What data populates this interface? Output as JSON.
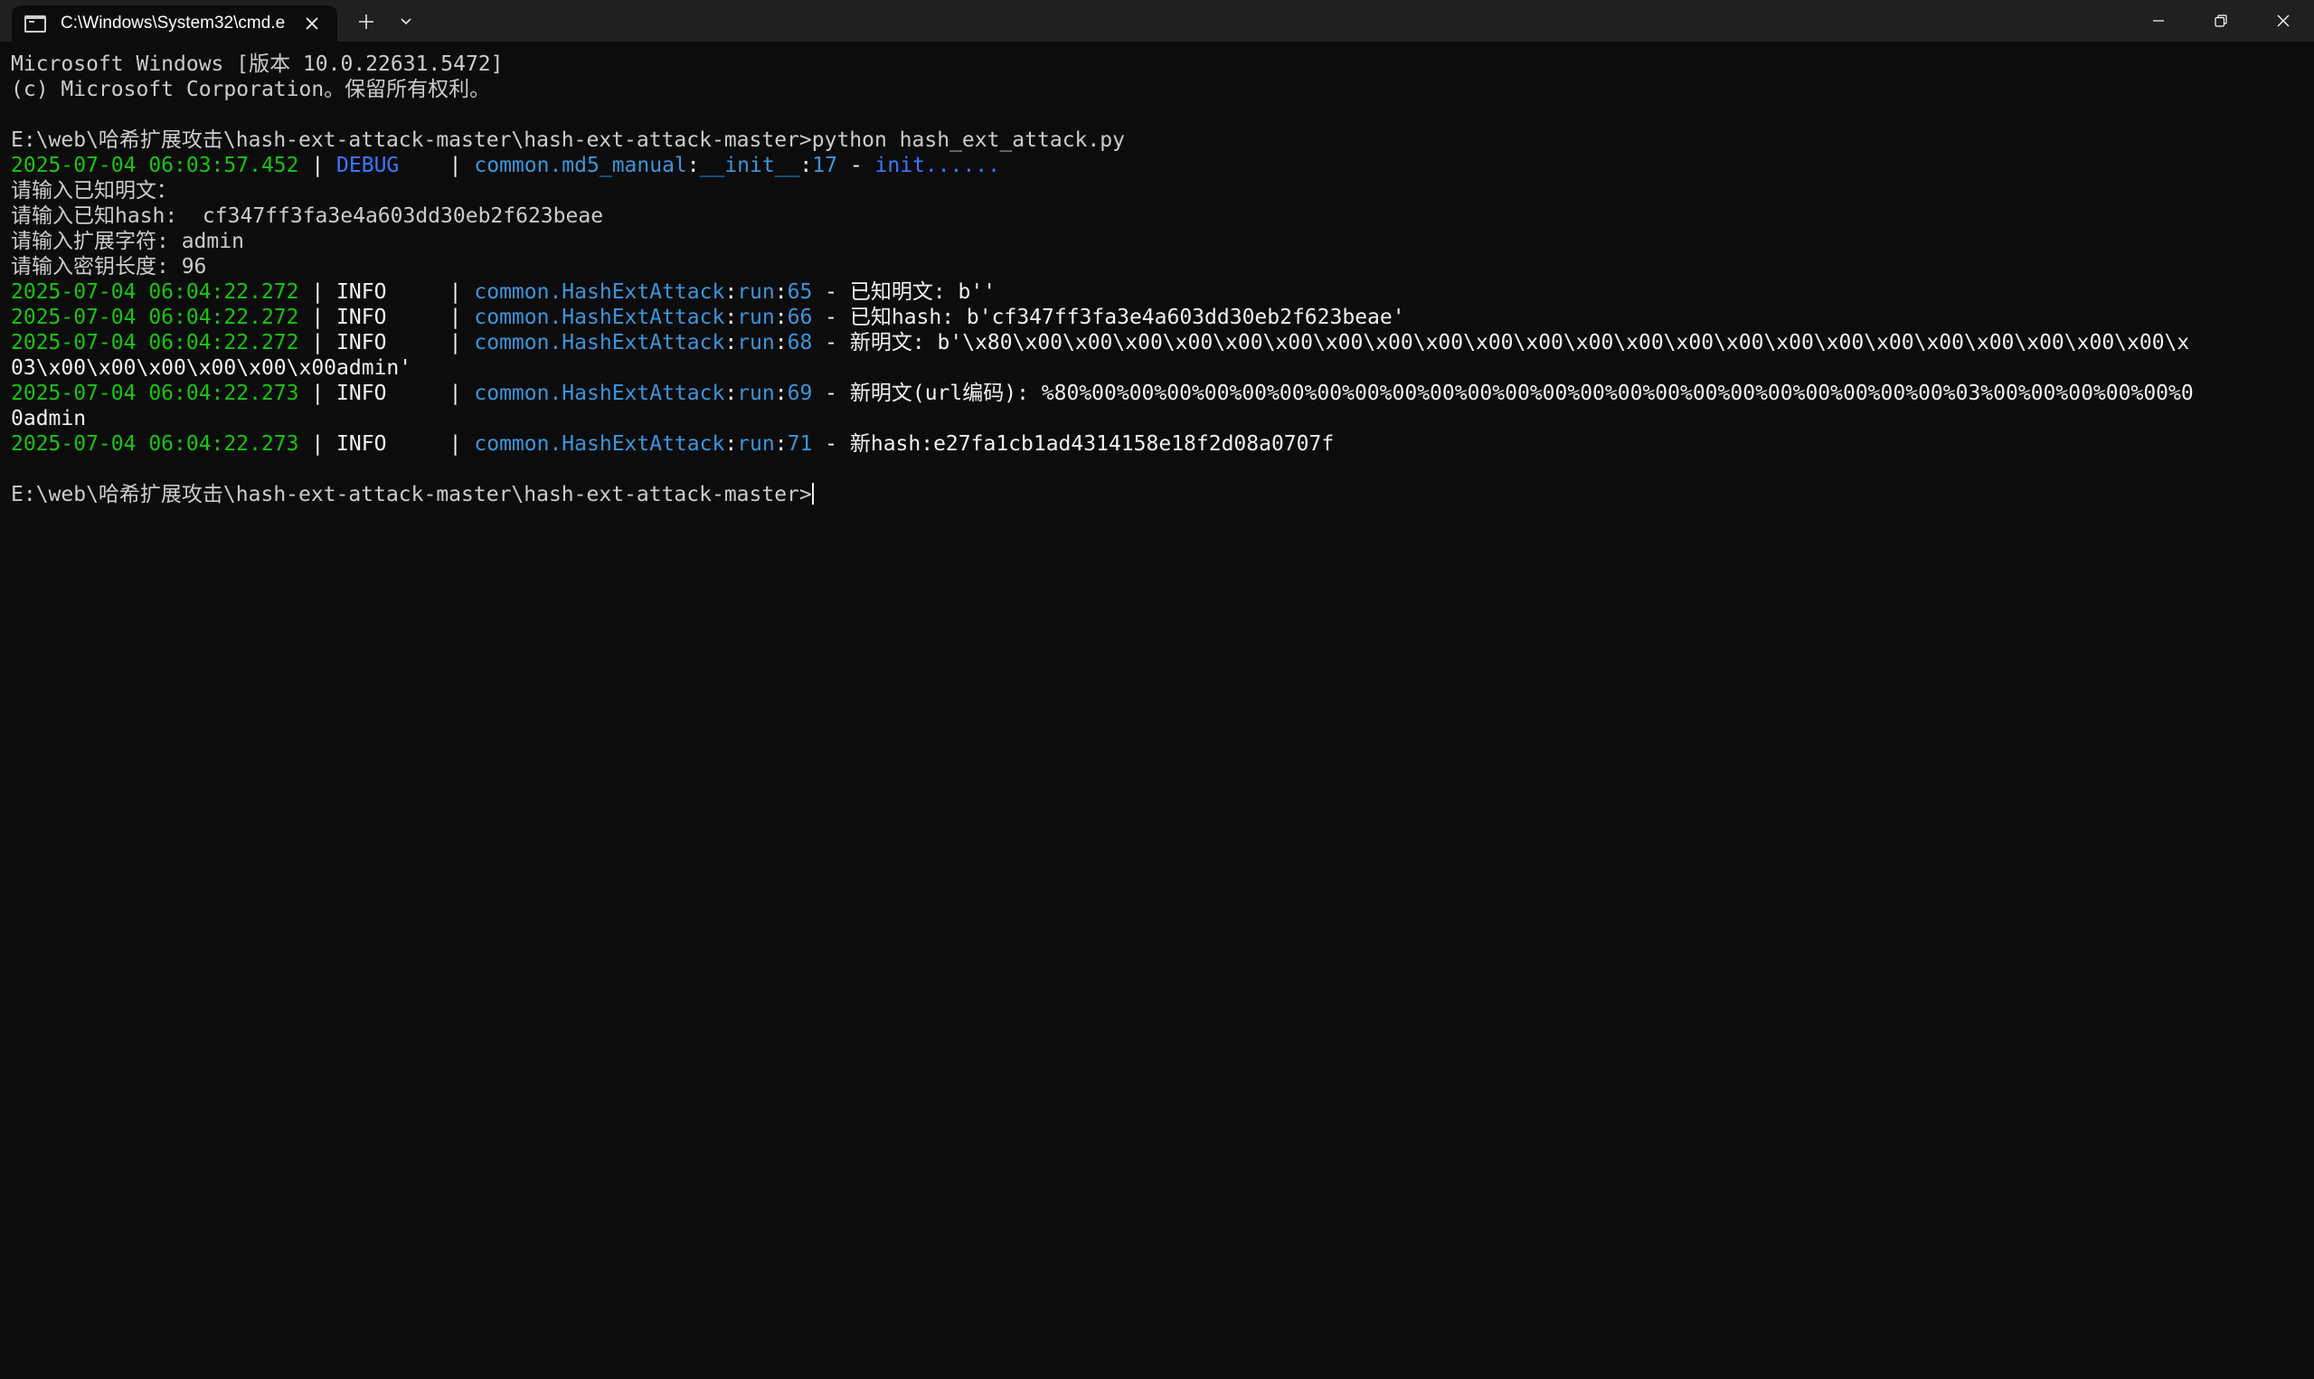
{
  "window": {
    "tab_title": "C:\\Windows\\System32\\cmd.e",
    "new_tab_label": "+"
  },
  "terminal": {
    "banner_line1": "Microsoft Windows [版本 10.0.22631.5472]",
    "banner_line2": "(c) Microsoft Corporation。保留所有权利。",
    "prompt1": "E:\\web\\哈希扩展攻击\\hash-ext-attack-master\\hash-ext-attack-master>",
    "command1": "python hash_ext_attack.py",
    "debug_line": {
      "timestamp": "2025-07-04 06:03:57.452",
      "sep1": " | ",
      "level": "DEBUG   ",
      "sep2": " | ",
      "module": "common.md5_manual",
      "colon1": ":",
      "func": "__init__",
      "colon2": ":",
      "lineno": "17",
      "dash": " - ",
      "message": "init......"
    },
    "input_prompts": [
      "请输入已知明文：",
      "请输入已知hash:  cf347ff3fa3e4a603dd30eb2f623beae",
      "请输入扩展字符: admin",
      "请输入密钥长度: 96"
    ],
    "info_lines": [
      {
        "timestamp": "2025-07-04 06:04:22.272",
        "level": "INFO    ",
        "module": "common.HashExtAttack",
        "func": "run",
        "lineno": "65",
        "message": "已知明文: b''"
      },
      {
        "timestamp": "2025-07-04 06:04:22.272",
        "level": "INFO    ",
        "module": "common.HashExtAttack",
        "func": "run",
        "lineno": "66",
        "message": "已知hash: b'cf347ff3fa3e4a603dd30eb2f623beae'"
      },
      {
        "timestamp": "2025-07-04 06:04:22.272",
        "level": "INFO    ",
        "module": "common.HashExtAttack",
        "func": "run",
        "lineno": "68",
        "message": "新明文: b'\\x80\\x00\\x00\\x00\\x00\\x00\\x00\\x00\\x00\\x00\\x00\\x00\\x00\\x00\\x00\\x00\\x00\\x00\\x00\\x00\\x00\\x00\\x00\\x00\\x",
        "wrap": "03\\x00\\x00\\x00\\x00\\x00\\x00admin'"
      },
      {
        "timestamp": "2025-07-04 06:04:22.273",
        "level": "INFO    ",
        "module": "common.HashExtAttack",
        "func": "run",
        "lineno": "69",
        "message": "新明文(url编码): %80%00%00%00%00%00%00%00%00%00%00%00%00%00%00%00%00%00%00%00%00%00%00%00%03%00%00%00%00%00%0",
        "wrap": "0admin"
      },
      {
        "timestamp": "2025-07-04 06:04:22.273",
        "level": "INFO    ",
        "module": "common.HashExtAttack",
        "func": "run",
        "lineno": "71",
        "message": "新hash:e27fa1cb1ad4314158e18f2d08a0707f"
      }
    ],
    "prompt2": "E:\\web\\哈希扩展攻击\\hash-ext-attack-master\\hash-ext-attack-master>"
  },
  "colors": {
    "background": "#0c0c0c",
    "titlebar": "#202020",
    "timestamp_green": "#16c60c",
    "debug_blue": "#3b78ff",
    "module_cyan": "#3a96dd",
    "text": "#cccccc"
  },
  "icons": {
    "tab_icon": "terminal-icon",
    "tab_close": "close-icon",
    "dropdown": "chevron-down-icon",
    "minimize": "minimize-icon",
    "maximize": "restore-icon",
    "close": "close-icon"
  }
}
